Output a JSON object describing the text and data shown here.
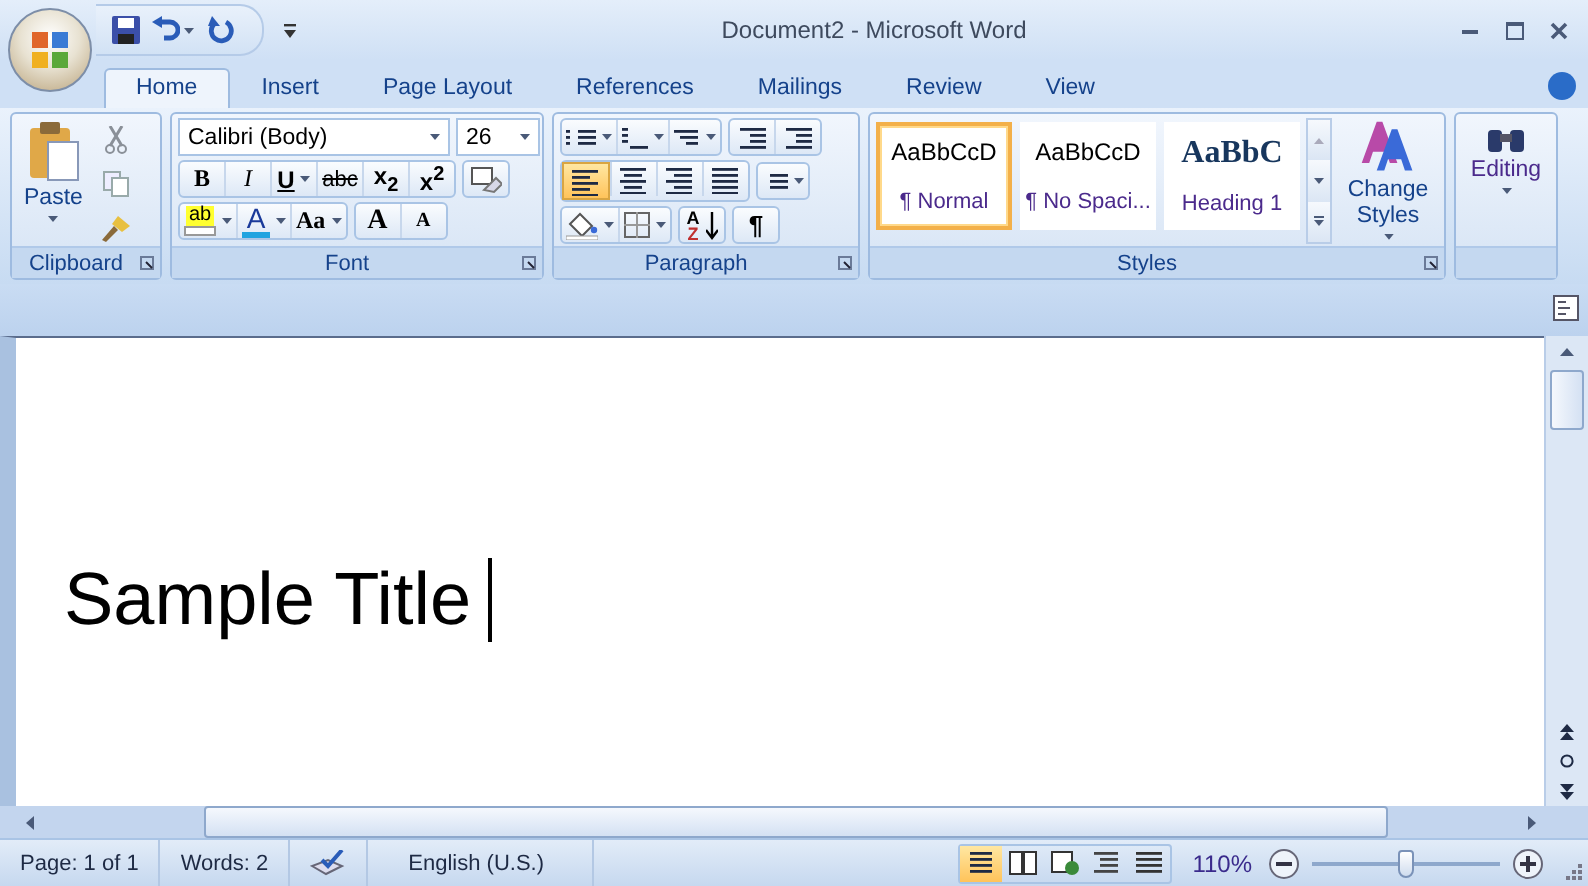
{
  "window": {
    "title": "Document2 - Microsoft Word"
  },
  "tabs": [
    {
      "label": "Home",
      "selected": true
    },
    {
      "label": "Insert",
      "selected": false
    },
    {
      "label": "Page Layout",
      "selected": false
    },
    {
      "label": "References",
      "selected": false
    },
    {
      "label": "Mailings",
      "selected": false
    },
    {
      "label": "Review",
      "selected": false
    },
    {
      "label": "View",
      "selected": false
    }
  ],
  "clipboard": {
    "label": "Clipboard",
    "paste": "Paste"
  },
  "font": {
    "label": "Font",
    "font_name": "Calibri (Body)",
    "font_size": "26",
    "format_buttons": [
      {
        "kind": "bold",
        "text": "B"
      },
      {
        "kind": "italic",
        "text": "I"
      },
      {
        "kind": "underline",
        "text": "U"
      },
      {
        "kind": "strikethrough",
        "text": "abc"
      },
      {
        "kind": "subscript",
        "text": "x$_{2}$"
      },
      {
        "kind": "superscript",
        "text": "x$^{2}$"
      }
    ],
    "highlight": "ab",
    "font_color": "A",
    "change_case": "Aa",
    "grow": "A",
    "shrink": "A"
  },
  "paragraph": {
    "label": "Paragraph",
    "alignment": [
      {
        "kind": "left",
        "selected": true
      },
      {
        "kind": "center",
        "selected": false
      },
      {
        "kind": "right",
        "selected": false
      },
      {
        "kind": "justify",
        "selected": false
      }
    ],
    "sort": {
      "top": "A",
      "bottom": "Z"
    },
    "show_marks": "¶"
  },
  "styles": {
    "label": "Styles",
    "gallery": [
      {
        "kind": "body",
        "preview": "AaBbCcD",
        "name": "¶ Normal",
        "selected": true
      },
      {
        "kind": "body",
        "preview": "AaBbCcD",
        "name": "¶ No Spaci...",
        "selected": false
      },
      {
        "kind": "heading",
        "preview": "AaBbC",
        "name": "Heading 1",
        "selected": false
      }
    ],
    "change_styles": "Change Styles"
  },
  "editing": {
    "label": "Editing"
  },
  "document": {
    "text": "Sample Title"
  },
  "status_bar": {
    "page": "Page: 1 of 1",
    "words": "Words: 2",
    "language": "English (U.S.)",
    "views": [
      {
        "kind": "print",
        "selected": true
      },
      {
        "kind": "reading",
        "selected": false
      },
      {
        "kind": "web",
        "selected": false
      },
      {
        "kind": "outline",
        "selected": false
      },
      {
        "kind": "draft",
        "selected": false
      }
    ],
    "zoom": "110%",
    "zoom_slider": {
      "level": 0.5
    }
  }
}
